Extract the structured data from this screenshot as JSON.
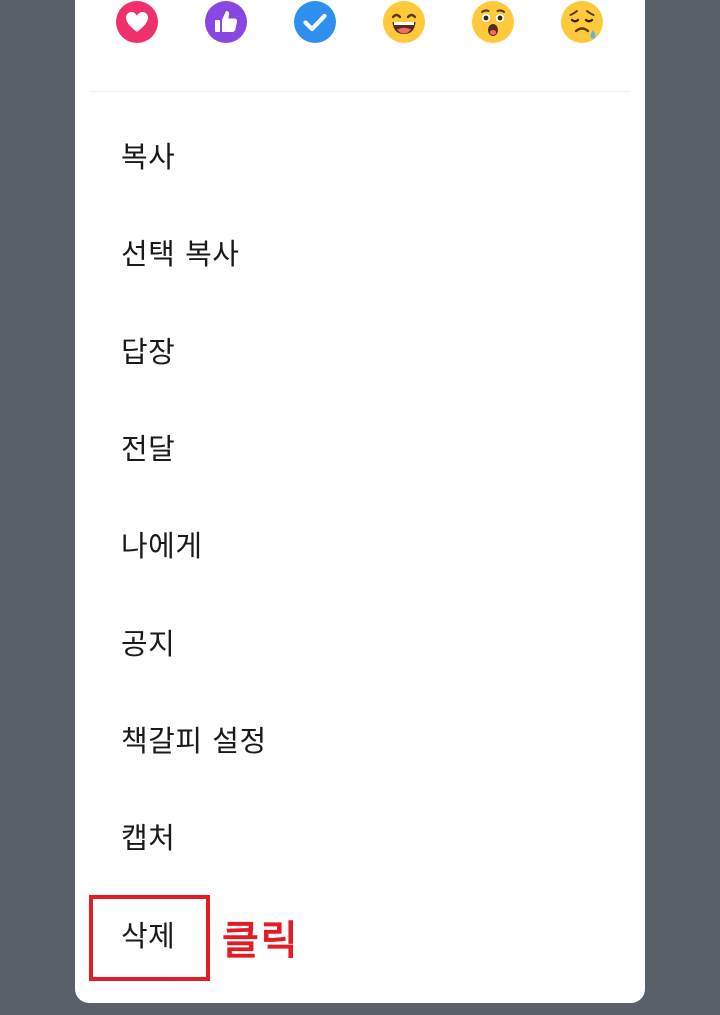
{
  "reactions": [
    {
      "icon": "heart-icon",
      "color": "#f0306a"
    },
    {
      "icon": "thumbs-up-icon",
      "color": "#8847e0"
    },
    {
      "icon": "check-icon",
      "color": "#2f8ff0"
    },
    {
      "icon": "laughing-face-icon",
      "color": "#ffc93c"
    },
    {
      "icon": "surprised-face-icon",
      "color": "#ffc93c"
    },
    {
      "icon": "sad-face-icon",
      "color": "#ffc93c"
    }
  ],
  "menu": {
    "items": [
      {
        "label": "복사"
      },
      {
        "label": "선택 복사"
      },
      {
        "label": "답장"
      },
      {
        "label": "전달"
      },
      {
        "label": "나에게"
      },
      {
        "label": "공지"
      },
      {
        "label": "책갈피 설정"
      },
      {
        "label": "캡처"
      },
      {
        "label": "삭제"
      }
    ]
  },
  "annotation": {
    "text": "클릭",
    "color": "#e11c24"
  }
}
